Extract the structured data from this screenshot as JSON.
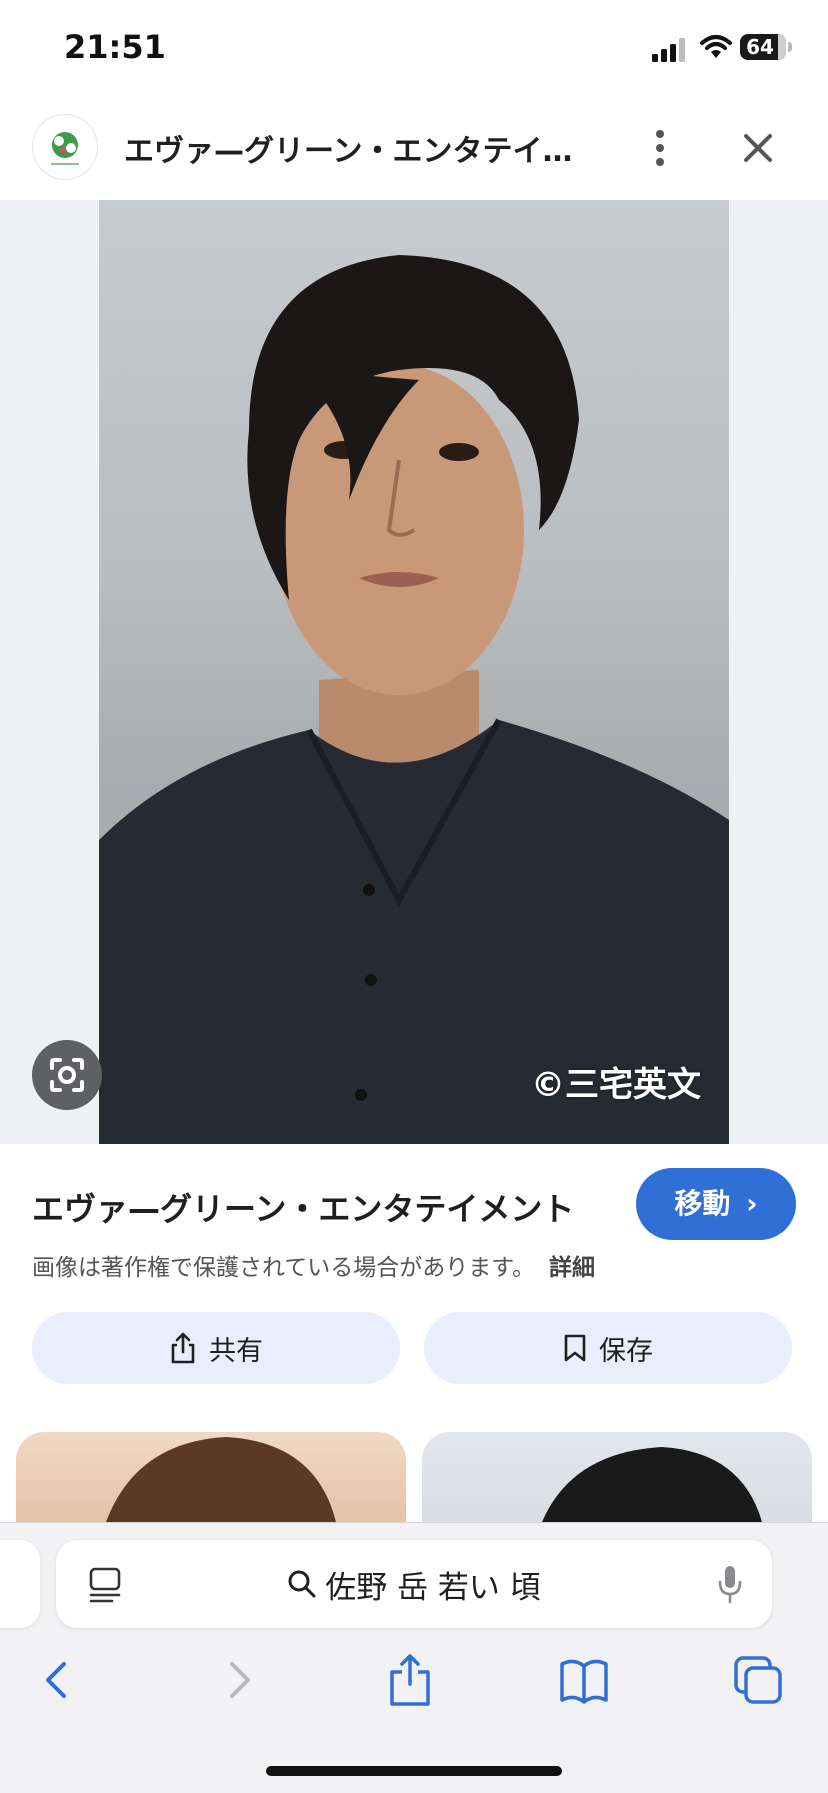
{
  "status_bar": {
    "time": "21:51",
    "battery": "64"
  },
  "header": {
    "title": "エヴァ—グリーン・エンタテイメン…"
  },
  "image": {
    "watermark": "©三宅英文"
  },
  "result": {
    "title": "エヴァ—グリーン・エンタテイメント",
    "visit_label": "移動",
    "copyright_note": "画像は著作権で保護されている場合があります。",
    "details_label": "詳細",
    "share_label": "共有",
    "save_label": "保存"
  },
  "address_bar": {
    "query": "佐野 岳 若い 頃"
  },
  "colors": {
    "accent": "#2f6fd6",
    "pill_bg": "#e8eefb"
  }
}
